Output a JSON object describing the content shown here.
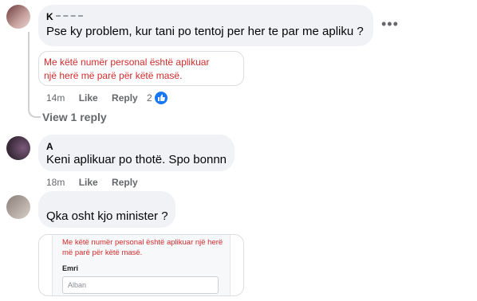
{
  "comments": [
    {
      "author": "K",
      "text": "Pse ky problem, kur tani po tentoj per her te par me apliku ?",
      "time": "14m",
      "like_label": "Like",
      "reply_label": "Reply",
      "reaction_count": "2",
      "attachment_text": "Me këtë numër personal është aplikuar një herë më parë për këtë masë."
    },
    {
      "author": "A",
      "text": "Keni aplikuar po thotë. Spo bonnn",
      "time": "18m",
      "like_label": "Like",
      "reply_label": "Reply"
    },
    {
      "author": "",
      "text": "Qka osht kjo minister ?",
      "attachment": {
        "error_text": "Me këtë numër personal është aplikuar një herë më parë për këtë masë.",
        "field_label": "Emri",
        "field_value": "Alban"
      }
    }
  ],
  "view_replies_label": "View 1 reply",
  "colors": {
    "bubble": "#f0f2f5",
    "error": "#d12b2b",
    "like": "#1877f2",
    "meta": "#65676b"
  }
}
